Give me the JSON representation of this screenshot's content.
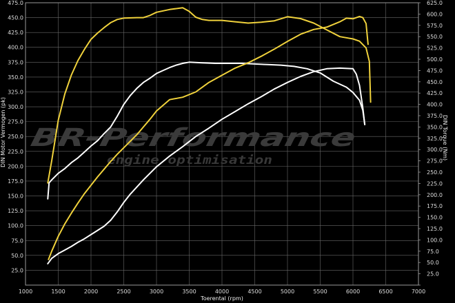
{
  "chart_data": {
    "type": "line",
    "xlabel": "Toerental (rpm)",
    "ylabel_left": "DIN Motor Vermogen (pk)",
    "ylabel_right": "DIN Torque (Nm)",
    "watermark": {
      "brand": "BR-Performance",
      "tagline": "engine optimisation"
    },
    "xlim": [
      1000,
      7000
    ],
    "ylim_left": [
      0,
      475
    ],
    "ylim_right": [
      0,
      625
    ],
    "x_ticks": [
      1000,
      1500,
      2000,
      2500,
      3000,
      3500,
      4000,
      4500,
      5000,
      5500,
      6000,
      6500,
      7000
    ],
    "y_left_ticks": [
      0,
      25,
      50,
      75,
      100,
      125,
      150,
      175,
      200,
      225,
      250,
      275,
      300,
      325,
      350,
      375,
      400,
      425,
      450,
      475
    ],
    "y_left_tick_labels": [
      "",
      "25.0",
      "50.0",
      "75.0",
      "100.0",
      "125.0",
      "150.0",
      "175.0",
      "200.0",
      "225.0",
      "250.0",
      "275.0",
      "300.0",
      "325.0",
      "350.0",
      "375.0",
      "400.0",
      "425.0",
      "450.0",
      "475.0"
    ],
    "y_right_ticks": [
      0,
      25,
      50,
      75,
      100,
      125,
      150,
      175,
      200,
      225,
      250,
      275,
      300,
      325,
      350,
      375,
      400,
      425,
      450,
      475,
      500,
      525,
      550,
      575,
      600,
      625
    ],
    "y_right_tick_labels": [
      "",
      "25.0",
      "50.0",
      "75.0",
      "100.0",
      "125.0",
      "150.0",
      "175.0",
      "200.0",
      "225.0",
      "250.0",
      "275.0",
      "300.0",
      "325.0",
      "350.0",
      "375.0",
      "400.0",
      "425.0",
      "450.0",
      "475.0",
      "500.0",
      "525.0",
      "550.0",
      "575.0",
      "600.0",
      "625.0"
    ],
    "grid": true,
    "series": [
      {
        "axis": "right",
        "color": "#f0d23c",
        "points": [
          [
            1340,
            226
          ],
          [
            1400,
            275
          ],
          [
            1500,
            365
          ],
          [
            1600,
            423
          ],
          [
            1700,
            465
          ],
          [
            1800,
            497
          ],
          [
            1900,
            522
          ],
          [
            2000,
            544
          ],
          [
            2100,
            558
          ],
          [
            2200,
            570
          ],
          [
            2300,
            581
          ],
          [
            2400,
            588
          ],
          [
            2500,
            591
          ],
          [
            2700,
            592
          ],
          [
            2800,
            592
          ],
          [
            2900,
            597
          ],
          [
            3000,
            604
          ],
          [
            3200,
            610
          ],
          [
            3400,
            614
          ],
          [
            3500,
            606
          ],
          [
            3600,
            593
          ],
          [
            3700,
            588
          ],
          [
            3800,
            586
          ],
          [
            4000,
            586
          ],
          [
            4200,
            583
          ],
          [
            4400,
            580
          ],
          [
            4600,
            582
          ],
          [
            4800,
            585
          ],
          [
            5000,
            594
          ],
          [
            5200,
            590
          ],
          [
            5400,
            580
          ],
          [
            5600,
            565
          ],
          [
            5800,
            550
          ],
          [
            6000,
            545
          ],
          [
            6100,
            540
          ],
          [
            6200,
            525
          ],
          [
            6250,
            495
          ],
          [
            6270,
            405
          ]
        ]
      },
      {
        "axis": "left",
        "color": "#ffffff",
        "points": [
          [
            1340,
            145
          ],
          [
            1360,
            172
          ],
          [
            1400,
            177
          ],
          [
            1500,
            188
          ],
          [
            1600,
            196
          ],
          [
            1700,
            206
          ],
          [
            1800,
            214
          ],
          [
            1900,
            224
          ],
          [
            2000,
            234
          ],
          [
            2100,
            243
          ],
          [
            2200,
            255
          ],
          [
            2300,
            266
          ],
          [
            2400,
            284
          ],
          [
            2500,
            304
          ],
          [
            2600,
            319
          ],
          [
            2700,
            331
          ],
          [
            2800,
            341
          ],
          [
            2900,
            348
          ],
          [
            3000,
            356
          ],
          [
            3100,
            361
          ],
          [
            3200,
            366
          ],
          [
            3300,
            370
          ],
          [
            3400,
            373
          ],
          [
            3500,
            375
          ],
          [
            3700,
            374
          ],
          [
            3900,
            373
          ],
          [
            4100,
            373
          ],
          [
            4300,
            373
          ],
          [
            4500,
            372
          ],
          [
            4700,
            371
          ],
          [
            4900,
            370
          ],
          [
            5100,
            368
          ],
          [
            5300,
            364
          ],
          [
            5500,
            357
          ],
          [
            5700,
            343
          ],
          [
            5900,
            333
          ],
          [
            6000,
            324
          ],
          [
            6100,
            311
          ],
          [
            6150,
            294
          ],
          [
            6180,
            270
          ]
        ]
      },
      {
        "axis": "left",
        "color": "#f0d23c",
        "points": [
          [
            1350,
            43
          ],
          [
            1400,
            57
          ],
          [
            1500,
            82
          ],
          [
            1600,
            103
          ],
          [
            1700,
            121
          ],
          [
            1800,
            138
          ],
          [
            1900,
            154
          ],
          [
            2000,
            168
          ],
          [
            2100,
            182
          ],
          [
            2200,
            195
          ],
          [
            2300,
            208
          ],
          [
            2400,
            220
          ],
          [
            2500,
            231
          ],
          [
            2600,
            242
          ],
          [
            2700,
            253
          ],
          [
            2800,
            266
          ],
          [
            2900,
            279
          ],
          [
            3000,
            293
          ],
          [
            3200,
            312
          ],
          [
            3400,
            316
          ],
          [
            3600,
            325
          ],
          [
            3800,
            341
          ],
          [
            4000,
            353
          ],
          [
            4200,
            365
          ],
          [
            4400,
            374
          ],
          [
            4600,
            385
          ],
          [
            4800,
            397
          ],
          [
            5000,
            410
          ],
          [
            5200,
            422
          ],
          [
            5400,
            430
          ],
          [
            5600,
            434
          ],
          [
            5800,
            443
          ],
          [
            5900,
            449
          ],
          [
            6000,
            448
          ],
          [
            6100,
            452
          ],
          [
            6150,
            450
          ],
          [
            6200,
            440
          ],
          [
            6230,
            405
          ]
        ]
      },
      {
        "axis": "left",
        "color": "#ffffff",
        "points": [
          [
            1340,
            36
          ],
          [
            1400,
            45
          ],
          [
            1500,
            53
          ],
          [
            1600,
            59
          ],
          [
            1700,
            65
          ],
          [
            1800,
            72
          ],
          [
            1900,
            78
          ],
          [
            2000,
            85
          ],
          [
            2100,
            92
          ],
          [
            2200,
            99
          ],
          [
            2300,
            109
          ],
          [
            2400,
            123
          ],
          [
            2500,
            139
          ],
          [
            2600,
            153
          ],
          [
            2700,
            165
          ],
          [
            2800,
            177
          ],
          [
            2900,
            188
          ],
          [
            3000,
            199
          ],
          [
            3200,
            217
          ],
          [
            3400,
            233
          ],
          [
            3600,
            250
          ],
          [
            3800,
            264
          ],
          [
            4000,
            279
          ],
          [
            4200,
            292
          ],
          [
            4400,
            305
          ],
          [
            4600,
            317
          ],
          [
            4800,
            330
          ],
          [
            5000,
            341
          ],
          [
            5200,
            351
          ],
          [
            5400,
            359
          ],
          [
            5600,
            364
          ],
          [
            5800,
            365
          ],
          [
            6000,
            364
          ],
          [
            6050,
            355
          ],
          [
            6100,
            336
          ],
          [
            6150,
            298
          ],
          [
            6180,
            270
          ]
        ]
      }
    ]
  }
}
